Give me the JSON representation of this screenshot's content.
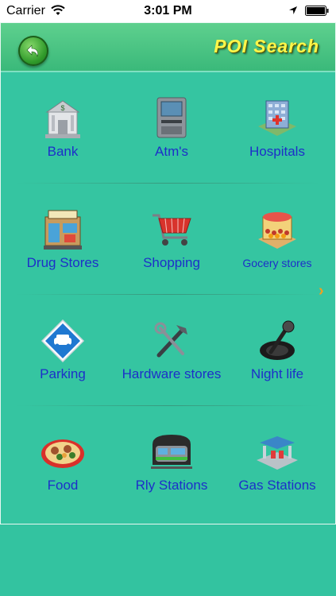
{
  "status_bar": {
    "carrier": "Carrier",
    "time": "3:01 PM",
    "wifi_icon": "wifi-icon",
    "location_icon": "location-arrow-icon",
    "battery_icon": "battery-icon"
  },
  "header": {
    "title": "POI Search",
    "back_icon": "back-arrow-icon",
    "title_color": "#fff64a",
    "bar_color": "#4cc486"
  },
  "categories": [
    [
      {
        "label": "Bank",
        "icon": "bank-icon"
      },
      {
        "label": "Atm's",
        "icon": "atm-icon"
      },
      {
        "label": "Hospitals",
        "icon": "hospital-icon"
      }
    ],
    [
      {
        "label": "Drug Stores",
        "icon": "drug-store-icon"
      },
      {
        "label": "Shopping",
        "icon": "shopping-cart-icon"
      },
      {
        "label": "Gocery stores",
        "icon": "grocery-store-icon"
      }
    ],
    [
      {
        "label": "Parking",
        "icon": "parking-sign-icon"
      },
      {
        "label": "Hardware stores",
        "icon": "hardware-tools-icon"
      },
      {
        "label": "Night life",
        "icon": "microphone-icon"
      }
    ],
    [
      {
        "label": "Food",
        "icon": "food-platter-icon"
      },
      {
        "label": "Rly Stations",
        "icon": "train-icon"
      },
      {
        "label": "Gas Stations",
        "icon": "gas-station-icon"
      }
    ]
  ],
  "next_page_icon": "chevron-right-icon",
  "colors": {
    "background": "#33c3a0",
    "label": "#1d2fc9",
    "accent_arrow": "#f0a020"
  }
}
